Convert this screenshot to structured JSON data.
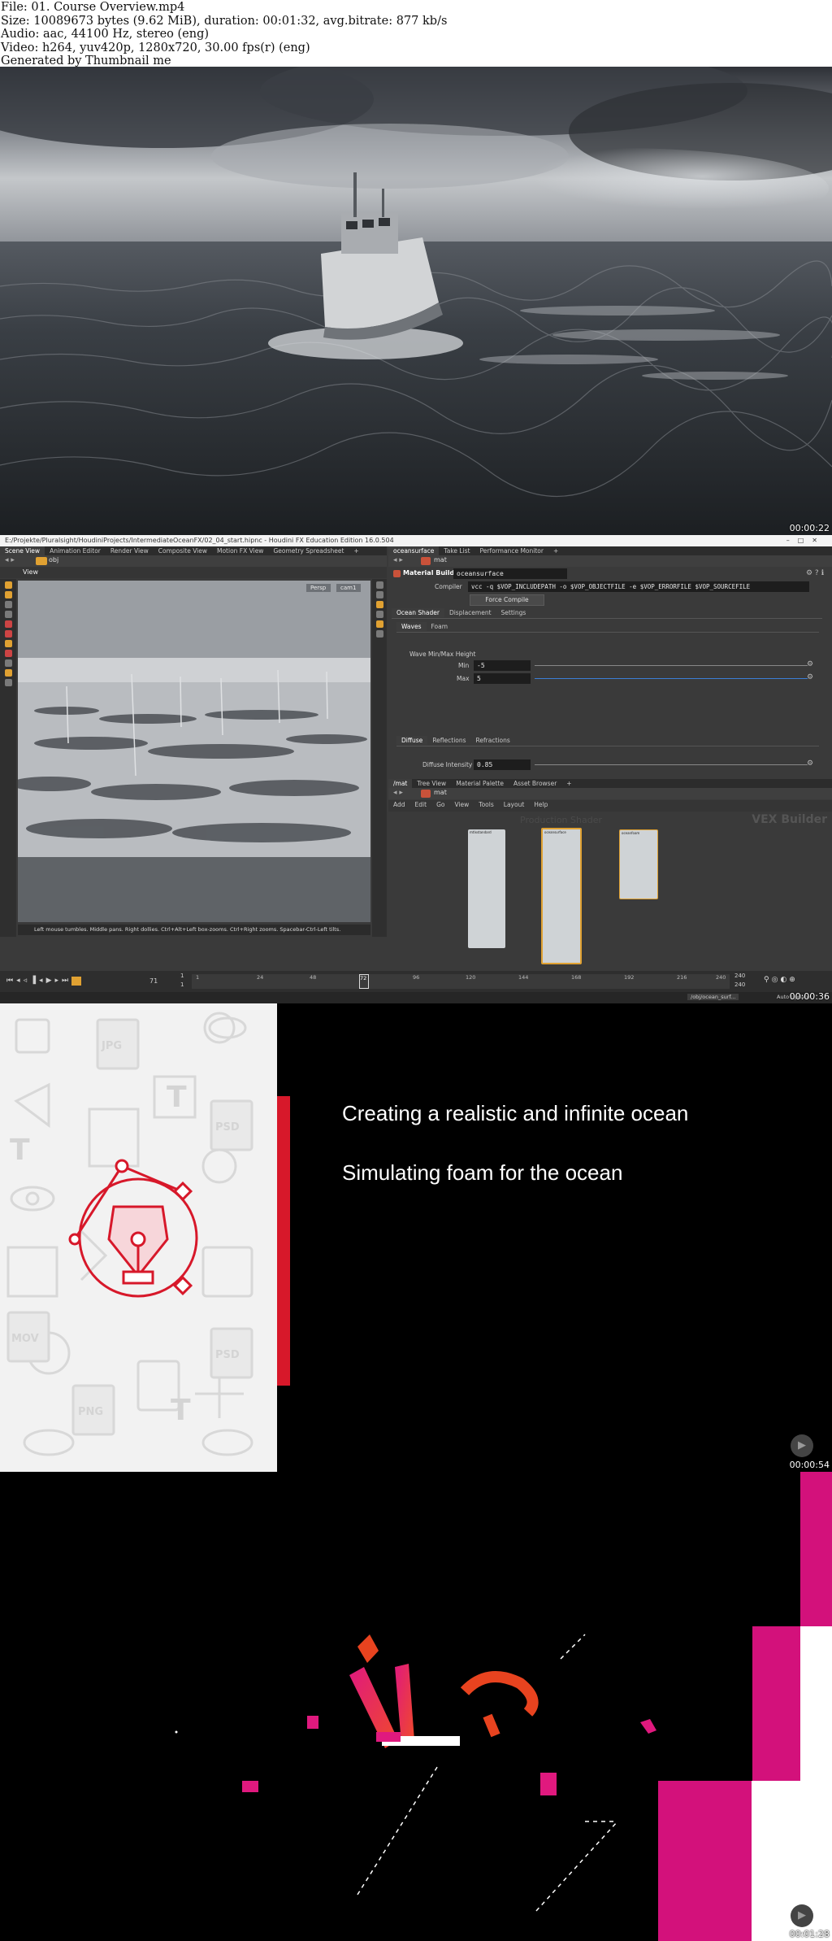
{
  "header": {
    "lines": [
      "File: 01. Course Overview.mp4",
      "Size: 10089673 bytes (9.62 MiB), duration: 00:01:32, avg.bitrate: 877 kb/s",
      "Audio: aac, 44100 Hz, stereo (eng)",
      "Video: h264, yuv420p, 1280x720, 30.00 fps(r) (eng)",
      "Generated by Thumbnail me"
    ]
  },
  "frames": [
    {
      "timestamp": "00:00:22"
    },
    {
      "timestamp": "00:00:36"
    },
    {
      "timestamp": "00:00:54"
    },
    {
      "timestamp": "00:01:28"
    }
  ],
  "houdini": {
    "window_title": "E:/Projekte/Pluralsight/HoudiniProjects/IntermediateOceanFX/02_04_start.hipnc - Houdini FX Education Edition 16.0.504",
    "left_tabs": [
      "Scene View",
      "Animation Editor",
      "Render View",
      "Composite View",
      "Motion FX View",
      "Geometry Spreadsheet"
    ],
    "left_path": "obj",
    "view_label": "View",
    "persp_label": "Persp",
    "cam_label": "cam1",
    "viewport_hint": "Left mouse tumbles. Middle pans. Right dollies. Ctrl+Alt+Left box-zooms. Ctrl+Right zooms. Spacebar-Ctrl-Left tilts.",
    "right_tabs": [
      "oceansurface",
      "Take List",
      "Performance Monitor"
    ],
    "right_path": "mat",
    "material_builder_label": "Material Builder",
    "material_name": "oceansurface",
    "compiler_label": "Compiler",
    "compiler_value": "vcc -q $VOP_INCLUDEPATH -o $VOP_OBJECTFILE -e $VOP_ERRORFILE $VOP_SOURCEFILE",
    "force_compile": "Force Compile",
    "param_tabs": [
      "Ocean Shader",
      "Displacement",
      "Settings"
    ],
    "sub_tabs": [
      "Waves",
      "Foam"
    ],
    "wave_group": "Wave Min/Max Height",
    "min_label": "Min",
    "min_value": "-5",
    "max_label": "Max",
    "max_value": "5",
    "diffuse_tabs": [
      "Diffuse",
      "Reflections",
      "Refractions"
    ],
    "diffuse_label": "Diffuse Intensity",
    "diffuse_value": "0.85",
    "net_tabs": [
      "/mat",
      "Tree View",
      "Material Palette",
      "Asset Browser"
    ],
    "net_path": "mat",
    "net_menu": [
      "Add",
      "Edit",
      "Go",
      "View",
      "Tools",
      "Layout",
      "Help"
    ],
    "vex_builder": "VEX Builder",
    "net_faint_label": "Production Shader",
    "node_names": [
      "mtlxstandard",
      "oceansurface",
      "oceanfoam"
    ],
    "timeline_frame": "71",
    "timeline_start": "1",
    "timeline_start2": "1",
    "timeline_ticks": [
      "1",
      "24",
      "48",
      "72",
      "96",
      "120",
      "144",
      "168",
      "192",
      "216",
      "240"
    ],
    "timeline_end": "240",
    "timeline_end2": "240",
    "status_path": "/obj/ocean_surf...",
    "auto_update": "Auto Update"
  },
  "course": {
    "topics": [
      "Creating a realistic and infinite ocean",
      "Simulating foam for the ocean"
    ],
    "pattern_glyphs": [
      "JPG",
      "PSD",
      "MOV",
      "PNG",
      "PSD",
      "T",
      "T",
      "T"
    ]
  },
  "colors": {
    "pluralsight_red": "#d7182a",
    "pluralsight_pink": "#e0197e",
    "houdini_orange": "#e0a132"
  }
}
